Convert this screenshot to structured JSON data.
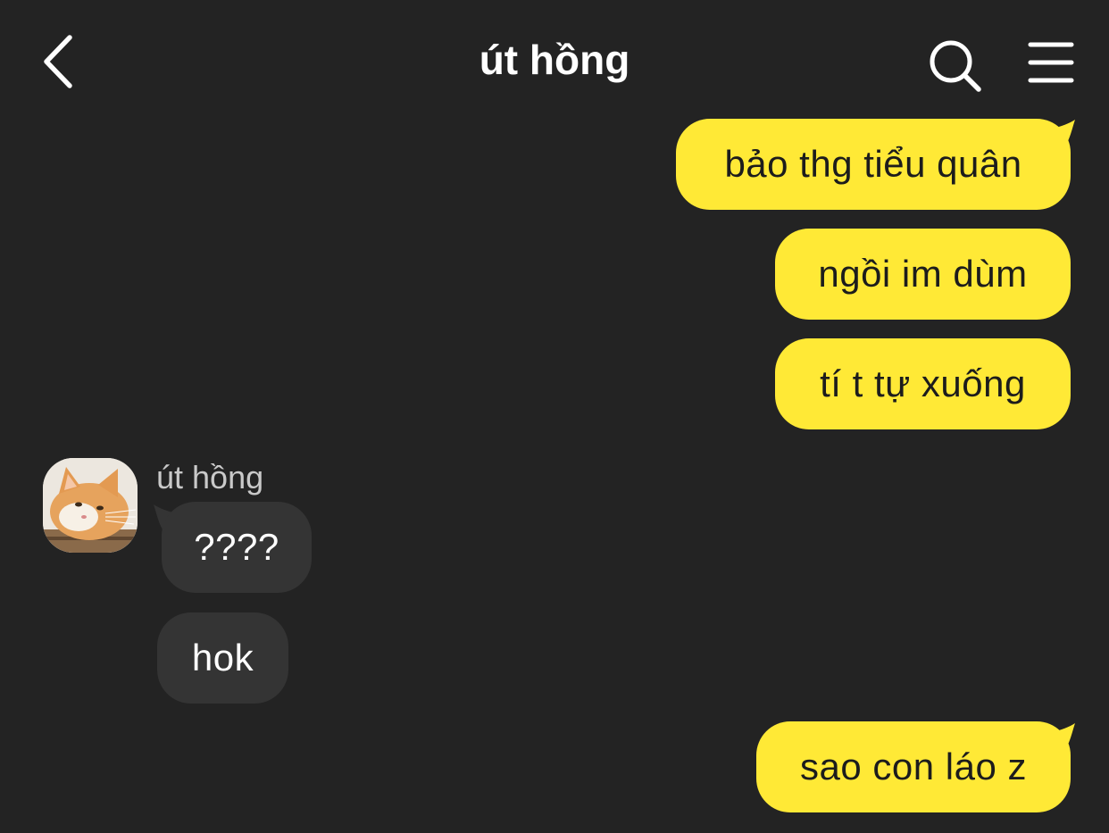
{
  "header": {
    "title": "út hồng",
    "back_icon": "chevron-left-icon",
    "search_icon": "search-icon",
    "menu_icon": "menu-icon"
  },
  "colors": {
    "background": "#232323",
    "my_bubble": "#ffe936",
    "their_bubble": "#343434",
    "sender_name": "#c9c9c9"
  },
  "contact": {
    "name": "út hồng",
    "avatar": "cat-avatar"
  },
  "messages": [
    {
      "from": "me",
      "text": "bảo thg tiểu quân"
    },
    {
      "from": "me",
      "text": "ngồi im dùm"
    },
    {
      "from": "me",
      "text": "tí t tự xuống"
    },
    {
      "from": "them",
      "text": "????"
    },
    {
      "from": "them",
      "text": "hok"
    },
    {
      "from": "me",
      "text": "sao con láo z"
    }
  ]
}
